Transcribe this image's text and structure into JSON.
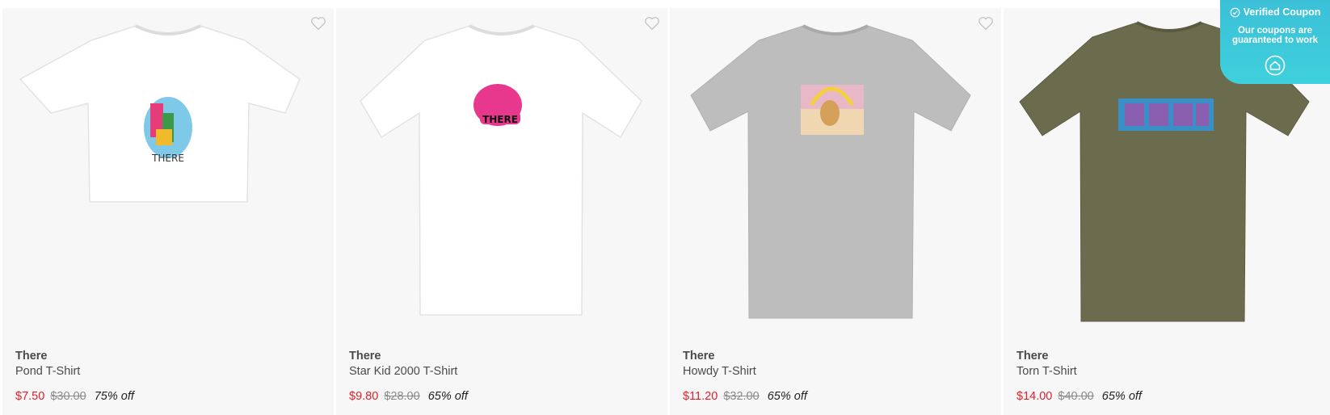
{
  "products": [
    {
      "brand": "There",
      "name": "Pond T-Shirt",
      "sale_price": "$7.50",
      "original_price": "$30.00",
      "discount": "75% off",
      "shirt_color": "#ffffff",
      "style": "cropped"
    },
    {
      "brand": "There",
      "name": "Star Kid 2000 T-Shirt",
      "sale_price": "$9.80",
      "original_price": "$28.00",
      "discount": "65% off",
      "shirt_color": "#ffffff",
      "style": "long"
    },
    {
      "brand": "There",
      "name": "Howdy T-Shirt",
      "sale_price": "$11.20",
      "original_price": "$32.00",
      "discount": "65% off",
      "shirt_color": "#bdbdbd",
      "style": "regular"
    },
    {
      "brand": "There",
      "name": "Torn T-Shirt",
      "sale_price": "$14.00",
      "original_price": "$40.00",
      "discount": "65% off",
      "shirt_color": "#6b6b4e",
      "style": "regular"
    }
  ],
  "coupon_badge": {
    "title": "Verified Coupon",
    "subtitle": "Our coupons are guaranteed to work",
    "color": "#3cc8da"
  },
  "icons": {
    "favorite": "heart-outline-icon",
    "verified": "check-circle-icon",
    "badge_logo": "home-logo-icon"
  }
}
